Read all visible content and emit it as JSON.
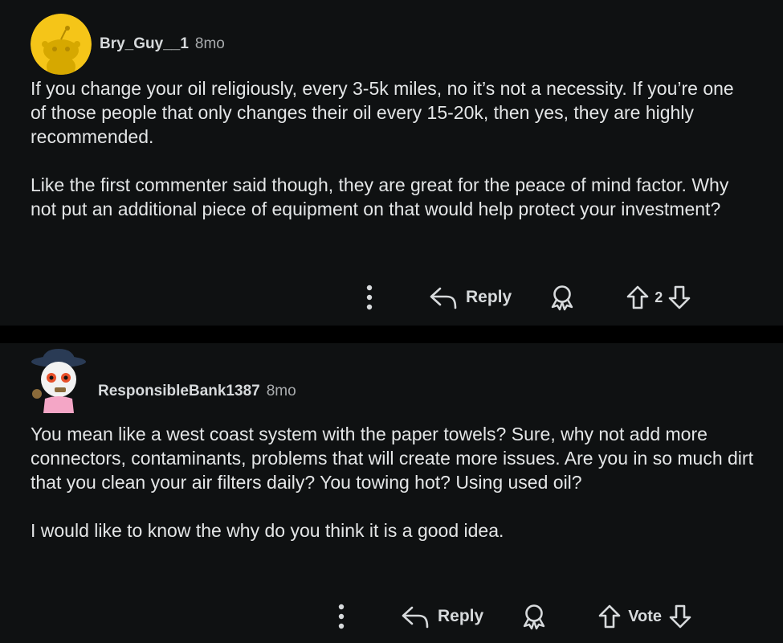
{
  "comments": [
    {
      "username": "Bry_Guy__1",
      "age": "8mo",
      "paragraphs": [
        "If you change your oil religiously, every 3-5k miles, no it’s not a necessity. If you’re one of those people that only changes their oil every 15-20k, then yes, they are highly recommended.",
        "Like the first commenter said though, they are great for the peace of mind factor. Why not put an additional piece of equipment on that would help protect your investment?"
      ],
      "reply_label": "Reply",
      "vote_label": "2"
    },
    {
      "username": "ResponsibleBank1387",
      "age": "8mo",
      "paragraphs": [
        "You mean like a west coast system with the paper towels? Sure, why not add more connectors, contaminants, problems that will create more issues. Are you in so much dirt that you clean your air filters daily? You towing hot? Using used oil?",
        "I would like to know the why do you think it is a good idea."
      ],
      "reply_label": "Reply",
      "vote_label": "Vote"
    }
  ],
  "icons": {
    "more": "more-options-icon",
    "reply": "reply-arrow-icon",
    "award": "award-icon",
    "upvote": "upvote-arrow-icon",
    "downvote": "downvote-arrow-icon"
  },
  "colors": {
    "background": "#0f1112",
    "divider": "#000000",
    "text": "#e4e6e7",
    "meta": "#a9acae",
    "avatar1": "#f5c518"
  }
}
